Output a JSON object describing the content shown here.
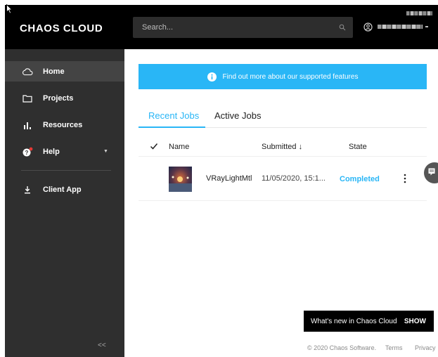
{
  "header": {
    "logo": "CHAOS CLOUD",
    "search_placeholder": "Search..."
  },
  "sidebar": {
    "items": [
      {
        "label": "Home",
        "icon": "cloud-icon"
      },
      {
        "label": "Projects",
        "icon": "folder-icon"
      },
      {
        "label": "Resources",
        "icon": "bar-chart-icon"
      },
      {
        "label": "Help",
        "icon": "help-icon"
      },
      {
        "label": "Client App",
        "icon": "download-icon"
      }
    ],
    "collapse_label": "<<"
  },
  "banner": {
    "text": "Find out more about our supported features"
  },
  "tabs": [
    {
      "label": "Recent Jobs",
      "selected": true
    },
    {
      "label": "Active Jobs",
      "selected": false
    }
  ],
  "table": {
    "columns": [
      "Name",
      "Submitted ↓",
      "State"
    ],
    "rows": [
      {
        "name": "VRayLightMtl",
        "submitted": "11/05/2020, 15:1...",
        "state": "Completed"
      }
    ]
  },
  "whats_new": {
    "text": "What's new in Chaos Cloud",
    "action": "SHOW"
  },
  "footer": {
    "copyright": "© 2020 Chaos Software.",
    "terms": "Terms",
    "privacy": "Privacy"
  },
  "colors": {
    "accent": "#29b6f6",
    "sidebar_bg": "#2f2f2f",
    "header_bg": "#000000"
  }
}
